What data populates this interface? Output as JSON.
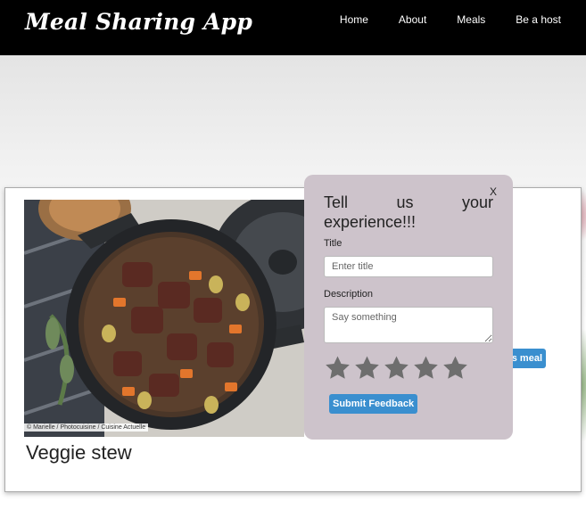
{
  "header": {
    "brand": "Meal Sharing App",
    "nav": [
      "Home",
      "About",
      "Meals",
      "Be a host"
    ]
  },
  "meal": {
    "title": "Veggie stew",
    "photo_credit": "© Marielle / Photocuisine / Cuisine Actuelle",
    "book_button_label": "s meal"
  },
  "feedback": {
    "close_label": "X",
    "heading": "Tell us your experience!!!",
    "title_label": "Title",
    "title_placeholder": "Enter title",
    "description_label": "Description",
    "description_placeholder": "Say something",
    "rating_stars": 5,
    "submit_label": "Submit Feedback"
  },
  "colors": {
    "header_bg": "#000000",
    "modal_bg": "#cdc3cb",
    "accent": "#3a8fcf",
    "star": "#6e6e6e"
  }
}
